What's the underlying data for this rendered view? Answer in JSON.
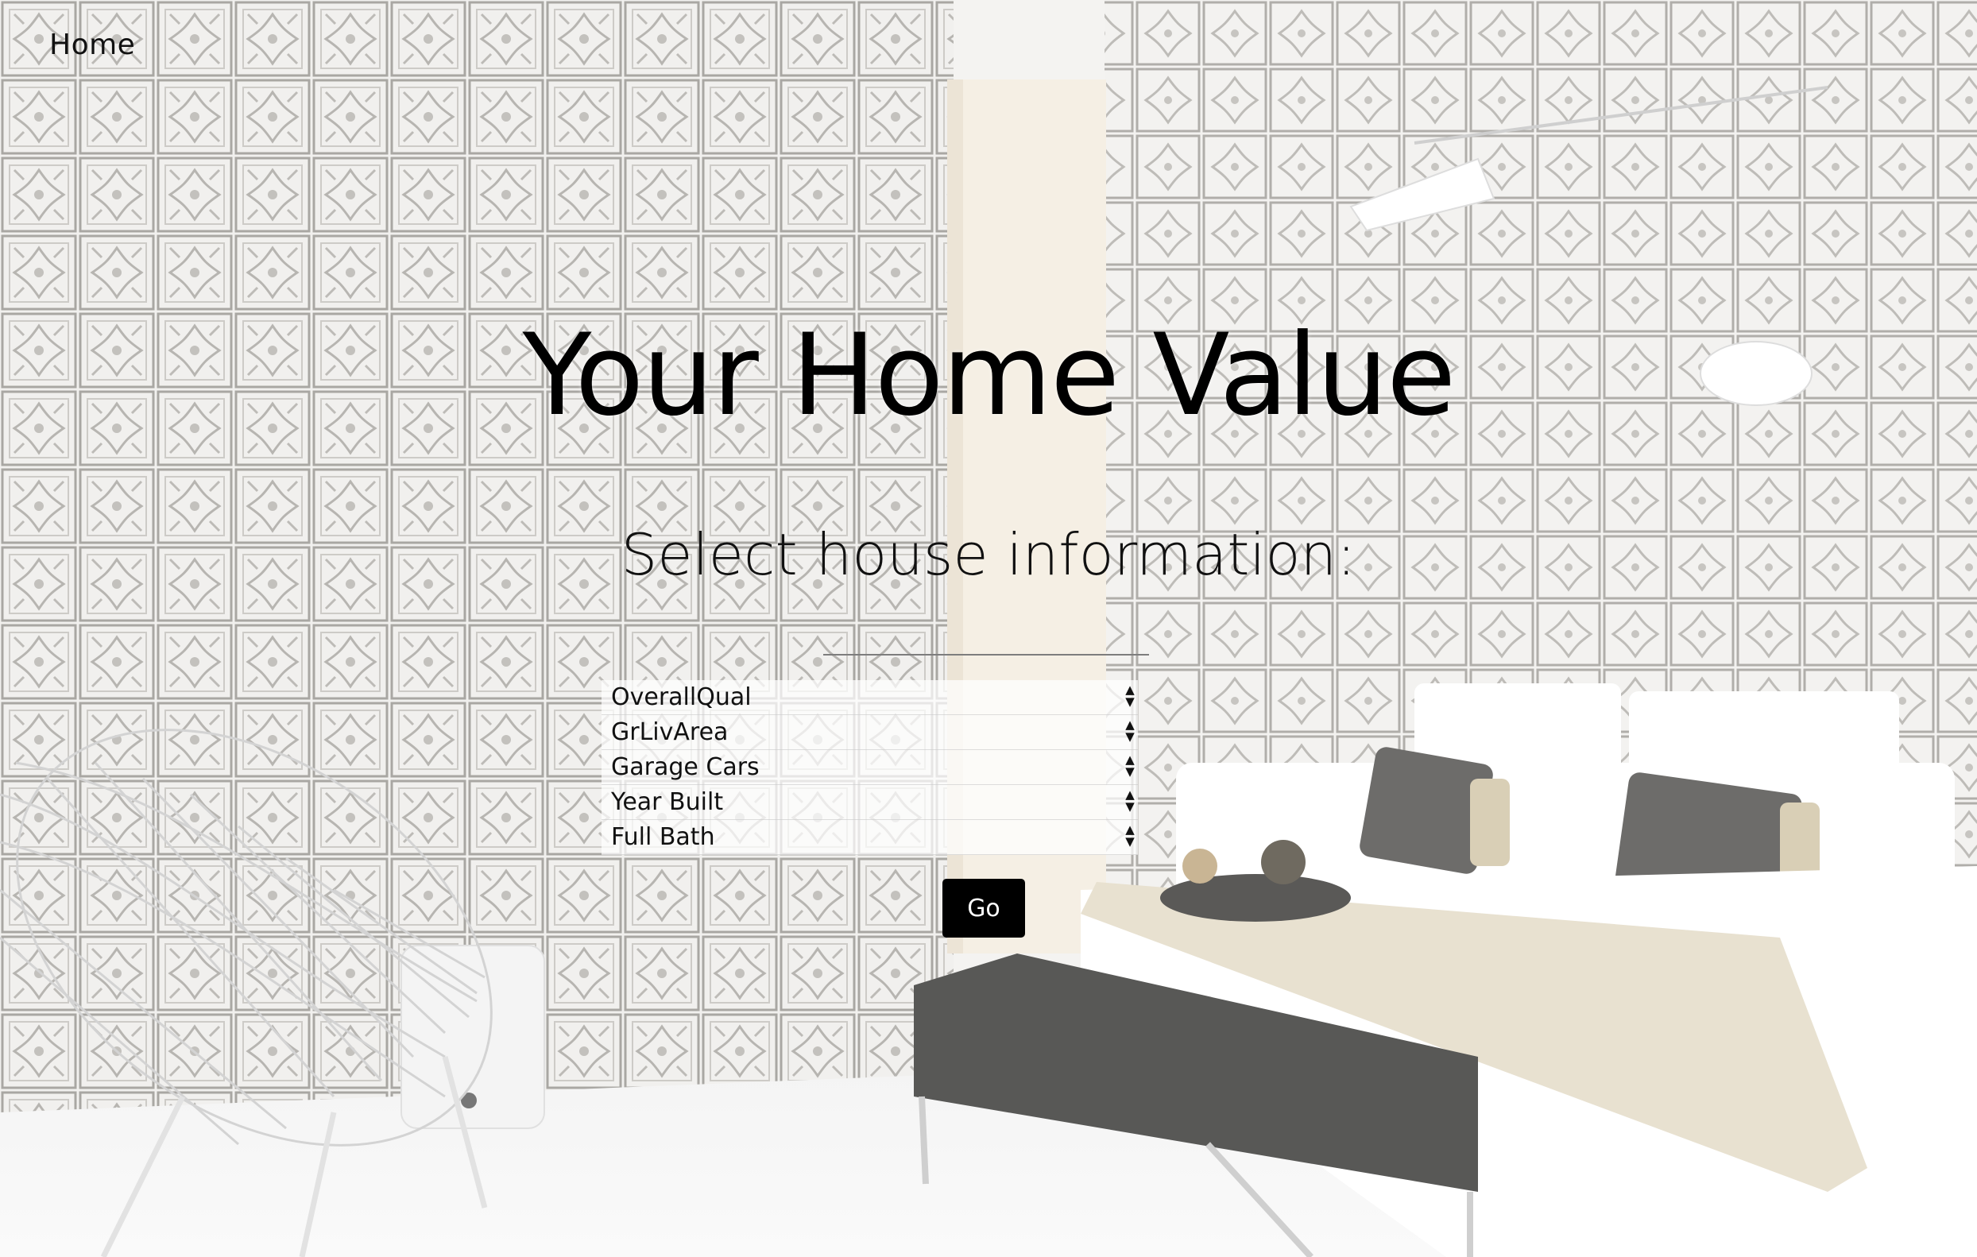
{
  "nav": {
    "home_label": "Home"
  },
  "hero": {
    "title": "Your Home Value",
    "subtitle": "Select house information:"
  },
  "form": {
    "selects": [
      {
        "label": "OverallQual"
      },
      {
        "label": "GrLivArea"
      },
      {
        "label": "Garage Cars"
      },
      {
        "label": "Year Built"
      },
      {
        "label": "Full Bath"
      }
    ],
    "submit_label": "Go"
  },
  "icons": {
    "select_arrows": "up-down-arrows-icon"
  },
  "colors": {
    "text": "#000000",
    "button_bg": "#000000",
    "button_text": "#ffffff",
    "select_bg": "#ffffffb8"
  }
}
